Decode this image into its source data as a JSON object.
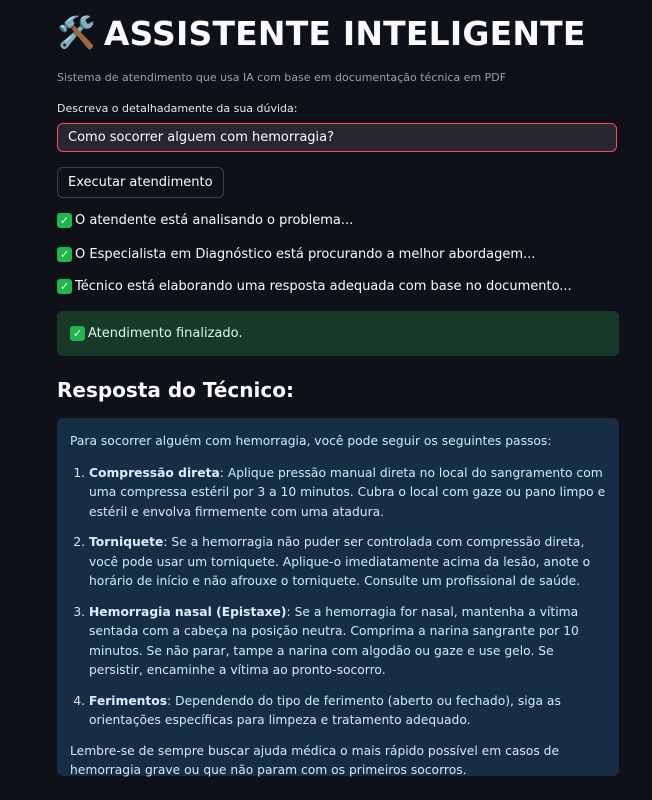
{
  "header": {
    "icon": "🛠️",
    "title": "ASSISTENTE INTELIGENTE",
    "subtitle": "Sistema de atendimento que usa IA com base em documentação técnica em PDF"
  },
  "form": {
    "label": "Descreva o detalhadamente da sua dúvida:",
    "input_value": "Como socorrer alguem com hemorragia?",
    "button_label": "Executar atendimento"
  },
  "status_messages": [
    "O atendente está analisando o problema...",
    "O Especialista em Diagnóstico está procurando a melhor abordagem...",
    "Técnico está elaborando uma resposta adequada com base no documento..."
  ],
  "success_message": "Atendimento finalizado.",
  "response": {
    "title": "Resposta do Técnico:",
    "intro": "Para socorrer alguém com hemorragia, você pode seguir os seguintes passos:",
    "steps": [
      {
        "term": "Compressão direta",
        "text": ": Aplique pressão manual direta no local do sangramento com uma compressa estéril por 3 a 10 minutos. Cubra o local com gaze ou pano limpo e estéril e envolva firmemente com uma atadura."
      },
      {
        "term": "Torniquete",
        "text": ": Se a hemorragia não puder ser controlada com compressão direta, você pode usar um torniquete. Aplique-o imediatamente acima da lesão, anote o horário de início e não afrouxe o torniquete. Consulte um profissional de saúde."
      },
      {
        "term": "Hemorragia nasal (Epistaxe)",
        "text": ": Se a hemorragia for nasal, mantenha a vítima sentada com a cabeça na posição neutra. Comprima a narina sangrante por 10 minutos. Se não parar, tampe a narina com algodão ou gaze e use gelo. Se persistir, encaminhe a vítima ao pronto-socorro."
      },
      {
        "term": "Ferimentos",
        "text": ": Dependendo do tipo de ferimento (aberto ou fechado), siga as orientações específicas para limpeza e tratamento adequado."
      }
    ],
    "outro": "Lembre-se de sempre buscar ajuda médica o mais rápido possível em casos de hemorragia grave ou que não param com os primeiros socorros."
  },
  "colors": {
    "background": "#0e1117",
    "input_border": "#ff4b4b",
    "success_bg": "#173928",
    "answer_bg": "#172d43",
    "check_green": "#21b64c"
  }
}
